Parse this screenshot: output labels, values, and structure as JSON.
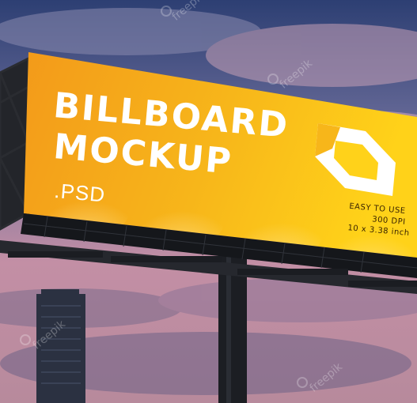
{
  "billboard": {
    "headline_line1": "BILLBOARD",
    "headline_line2": "MOCKUP",
    "suffix": ".PSD",
    "specs": [
      "EASY TO USE",
      "300 DPI",
      "10 x 3.38 inch"
    ]
  },
  "watermark": "freepik",
  "colors": {
    "sky_top": "#3b4f84",
    "sky_mid": "#b07f9b",
    "sky_bottom": "#d49aa8",
    "board_orange": "#f5a21c",
    "board_yellow": "#ffd21a",
    "structure_dark": "#1f2126"
  }
}
